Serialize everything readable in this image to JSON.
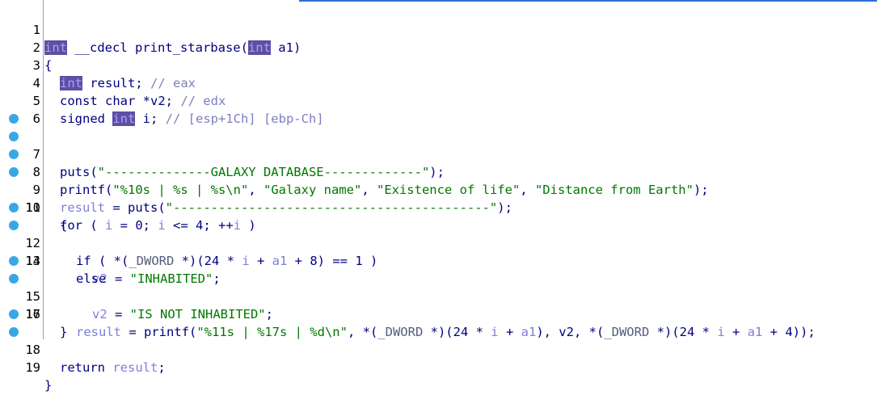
{
  "editor": {
    "lines": [
      {
        "no": "1",
        "bp": false
      },
      {
        "no": "2",
        "bp": false
      },
      {
        "no": "3",
        "bp": false
      },
      {
        "no": "4",
        "bp": false
      },
      {
        "no": "5",
        "bp": false
      },
      {
        "no": "6",
        "bp": false
      },
      {
        "no": "7",
        "bp": true
      },
      {
        "no": "8",
        "bp": true
      },
      {
        "no": "9",
        "bp": true
      },
      {
        "no": "10",
        "bp": true
      },
      {
        "no": "11",
        "bp": false
      },
      {
        "no": "12",
        "bp": true
      },
      {
        "no": "13",
        "bp": true
      },
      {
        "no": "14",
        "bp": false
      },
      {
        "no": "15",
        "bp": true
      },
      {
        "no": "16",
        "bp": true
      },
      {
        "no": "17",
        "bp": false
      },
      {
        "no": "18",
        "bp": true
      },
      {
        "no": "19",
        "bp": true
      }
    ],
    "tokens": {
      "l1_int": "int",
      "l1_rest": " __cdecl print_starbase(",
      "l1_int2": "int",
      "l1_end": " a1)",
      "l2": "{",
      "l3_int": "int",
      "l3_rest": " result; ",
      "l3_cmt": "// eax",
      "l4_rest": "const char *v2; ",
      "l4_cmt": "// edx",
      "l5_pre": "signed ",
      "l5_int": "int",
      "l5_rest": " i; ",
      "l5_cmt": "// [esp+1Ch] [ebp-Ch]",
      "l6": "",
      "l7_pre": "puts(",
      "l7_str": "\"--------------GALAXY DATABASE-------------\"",
      "l7_end": ");",
      "l8_pre": "printf(",
      "l8_s1": "\"%10s | %s | %s\\n\"",
      "l8_c1": ", ",
      "l8_s2": "\"Galaxy name\"",
      "l8_c2": ", ",
      "l8_s3": "\"Existence of life\"",
      "l8_c3": ", ",
      "l8_s4": "\"Distance from Earth\"",
      "l8_end": ");",
      "l9_var": "result",
      "l9_mid": " = puts(",
      "l9_str": "\"------------------------------------------\"",
      "l9_end": ");",
      "l10_pre": "for ( ",
      "l10_i1": "i",
      "l10_m1": " = 0; ",
      "l10_i2": "i",
      "l10_m2": " <= 4; ++",
      "l10_i3": "i",
      "l10_end": " )",
      "l11": "{",
      "l12_pre": "if ( *(",
      "l12_dw": "_DWORD",
      "l12_m1": " *)(24 * ",
      "l12_i": "i",
      "l12_m2": " + ",
      "l12_a1": "a1",
      "l12_end": " + 8) == 1 )",
      "l13_var": "v2",
      "l13_mid": " = ",
      "l13_str": "\"INHABITED\"",
      "l13_end": ";",
      "l14": "else",
      "l15_var": "v2",
      "l15_mid": " = ",
      "l15_str": "\"IS NOT INHABITED\"",
      "l15_end": ";",
      "l16_var": "result",
      "l16_m1": " = printf(",
      "l16_str": "\"%11s | %17s | %d\\n\"",
      "l16_m2": ", *(",
      "l16_dw1": "_DWORD",
      "l16_m3": " *)(24 * ",
      "l16_i1": "i",
      "l16_m4": " + ",
      "l16_a1": "a1",
      "l16_m5": "), v2, *(",
      "l16_dw2": "_DWORD",
      "l16_m6": " *)(24 * ",
      "l16_i2": "i",
      "l16_m7": " + ",
      "l16_a2": "a1",
      "l16_end": " + 4));",
      "l17": "}",
      "l18_pre": "return ",
      "l18_var": "result",
      "l18_end": ";",
      "l19": "}"
    }
  },
  "colors": {
    "keyword_highlight_bg": "#5f4ea2",
    "string": "#007800",
    "comment": "#7f7fbf",
    "variable": "#7f7fd8",
    "breakpoint": "#39a7e6"
  }
}
